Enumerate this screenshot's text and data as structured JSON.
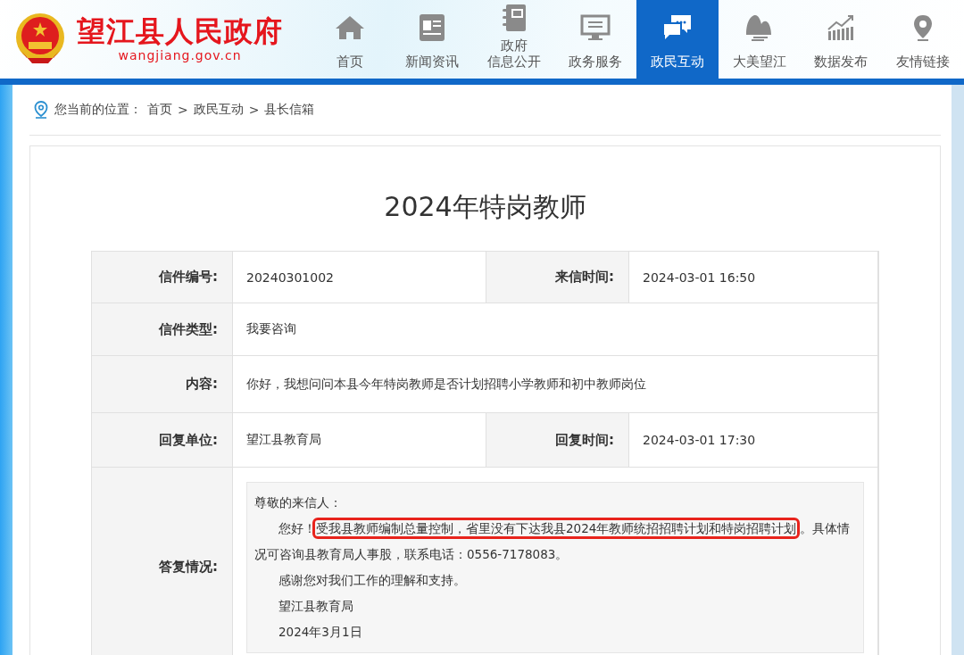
{
  "site": {
    "title": "望江县人民政府",
    "domain": "wangjiang.gov.cn"
  },
  "nav": [
    {
      "lines": [
        "首页"
      ],
      "selected": false
    },
    {
      "lines": [
        "新闻资讯"
      ],
      "selected": false
    },
    {
      "lines": [
        "政府",
        "信息公开"
      ],
      "selected": false
    },
    {
      "lines": [
        "政务服务"
      ],
      "selected": false
    },
    {
      "lines": [
        "政民互动"
      ],
      "selected": true
    },
    {
      "lines": [
        "大美望江"
      ],
      "selected": false
    },
    {
      "lines": [
        "数据发布"
      ],
      "selected": false
    },
    {
      "lines": [
        "友情链接"
      ],
      "selected": false
    }
  ],
  "breadcrumb": {
    "prefix": "您当前的位置：",
    "items": [
      "首页",
      "政民互动",
      "县长信箱"
    ],
    "separator": ">"
  },
  "letter": {
    "title": "2024年特岗教师",
    "rows": [
      {
        "kind": "pair",
        "cells": [
          {
            "label": "信件编号:",
            "value": "20240301002"
          },
          {
            "label": "来信时间:",
            "value": "2024-03-01 16:50"
          }
        ]
      },
      {
        "kind": "single",
        "cells": [
          {
            "label": "信件类型:",
            "value": "我要咨询"
          }
        ]
      },
      {
        "kind": "single",
        "cells": [
          {
            "label": "内容:",
            "value": "你好，我想问问本县今年特岗教师是否计划招聘小学教师和初中教师岗位"
          }
        ]
      },
      {
        "kind": "pair",
        "cells": [
          {
            "label": "回复单位:",
            "value": "望江县教育局"
          },
          {
            "label": "回复时间:",
            "value": "2024-03-01 17:30"
          }
        ]
      }
    ],
    "reply": {
      "label": "答复情况:",
      "salutation": "尊敬的来信人：",
      "paragraphs": [
        [
          {
            "text": "您好！",
            "highlighted": false
          },
          {
            "text": "受我县教师编制总量控制，省里没有下达我县2024年教师统招招聘计划和特岗招聘计划",
            "highlighted": true
          },
          {
            "text": "。具体情况可咨询县教育局人事股，联系电话：0556-7178083。",
            "highlighted": false
          }
        ],
        [
          {
            "text": "感谢您对我们工作的理解和支持。",
            "highlighted": false
          }
        ],
        [
          {
            "text": "望江县教育局",
            "highlighted": false
          }
        ],
        [
          {
            "text": "2024年3月1日",
            "highlighted": false
          }
        ]
      ]
    }
  }
}
